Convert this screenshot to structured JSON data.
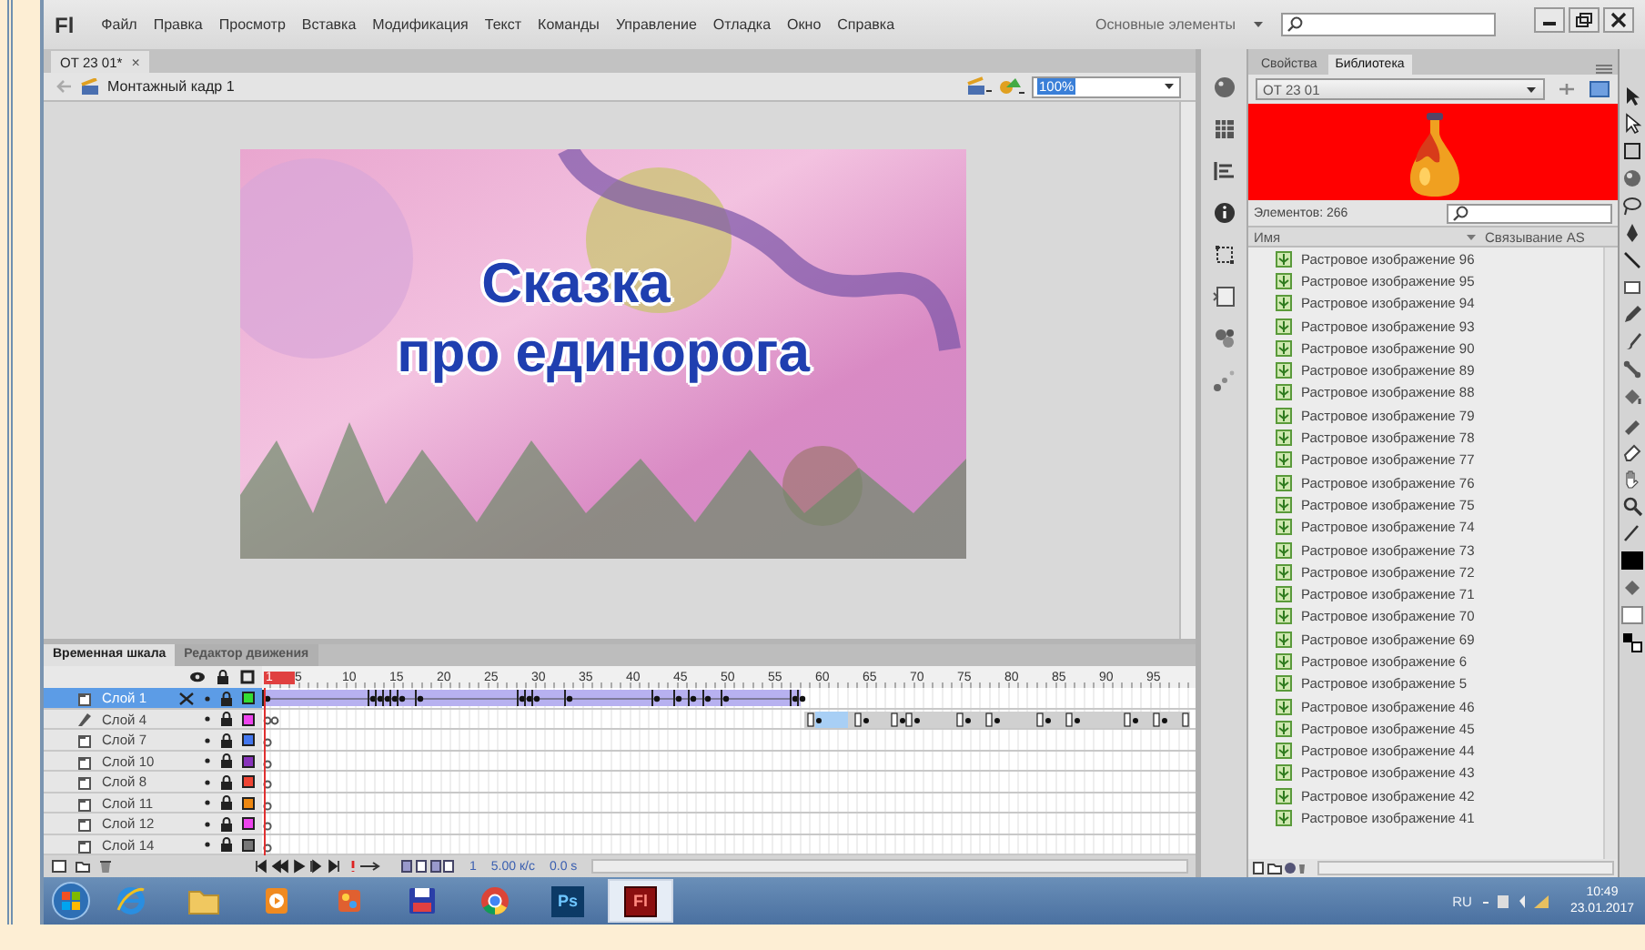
{
  "app": {
    "logo": "Fl",
    "menu": [
      "Файл",
      "Правка",
      "Просмотр",
      "Вставка",
      "Модификация",
      "Текст",
      "Команды",
      "Управление",
      "Отладка",
      "Окно",
      "Справка"
    ],
    "workspace": "Основные элементы"
  },
  "document_tab": {
    "title": "ОТ 23 01*",
    "close": "×"
  },
  "edit_bar": {
    "scene": "Монтажный кадр 1",
    "zoom": "100%"
  },
  "stage": {
    "lines": [
      "Сказка",
      "про единорога"
    ]
  },
  "timeline": {
    "tabs": [
      {
        "label": "Временная шкала",
        "selected": true
      },
      {
        "label": "Редактор движения",
        "selected": false
      }
    ],
    "frame_numbers": [
      "1",
      "5",
      "10",
      "15",
      "20",
      "25",
      "30",
      "35",
      "40",
      "45",
      "50",
      "55",
      "60",
      "65",
      "70",
      "75",
      "80",
      "85",
      "90",
      "95"
    ],
    "layers": [
      {
        "name": "Слой 1",
        "kind": "normal",
        "frames": {
          "kind": "tween"
        },
        "selected": true,
        "color": "#33dd33"
      },
      {
        "name": "Слой 4",
        "kind": "guide",
        "frames": {
          "kind": "keys"
        },
        "selected": false,
        "color": "#ee44ee"
      },
      {
        "name": "Слой 7",
        "kind": "normal",
        "frames": {
          "kind": "empty"
        },
        "selected": false,
        "color": "#4477ee"
      },
      {
        "name": "Слой 10",
        "kind": "normal",
        "frames": {
          "kind": "empty"
        },
        "selected": false,
        "color": "#8833bb"
      },
      {
        "name": "Слой 8",
        "kind": "normal",
        "frames": {
          "kind": "empty"
        },
        "selected": false,
        "color": "#ee4433"
      },
      {
        "name": "Слой 11",
        "kind": "normal",
        "frames": {
          "kind": "empty"
        },
        "selected": false,
        "color": "#ee8811"
      },
      {
        "name": "Слой 12",
        "kind": "normal",
        "frames": {
          "kind": "empty"
        },
        "selected": false,
        "color": "#ee44ee"
      },
      {
        "name": "Слой 14",
        "kind": "normal",
        "frames": {
          "kind": "empty"
        },
        "selected": false,
        "color": "#777777"
      }
    ],
    "current_frame": "1",
    "fps": "5.00 к/с",
    "time": "0.0 s"
  },
  "library": {
    "tabs": [
      {
        "label": "Свойства",
        "selected": false
      },
      {
        "label": "Библиотека",
        "selected": true
      }
    ],
    "document": "ОТ 23 01",
    "count": "Элементов: 266",
    "columns": [
      "Имя",
      "Связывание AS"
    ],
    "items": [
      "Растровое изображение 96",
      "Растровое изображение 95",
      "Растровое изображение 94",
      "Растровое изображение 93",
      "Растровое изображение 90",
      "Растровое изображение 89",
      "Растровое изображение 88",
      "Растровое изображение 79",
      "Растровое изображение 78",
      "Растровое изображение 77",
      "Растровое изображение 76",
      "Растровое изображение 75",
      "Растровое изображение 74",
      "Растровое изображение 73",
      "Растровое изображение 72",
      "Растровое изображение 71",
      "Растровое изображение 70",
      "Растровое изображение 69",
      "Растровое изображение 6",
      "Растровое изображение 5",
      "Растровое изображение 46",
      "Растровое изображение 45",
      "Растровое изображение 44",
      "Растровое изображение 43",
      "Растровое изображение 42",
      "Растровое изображение 41"
    ]
  },
  "taskbar": {
    "apps": [
      {
        "kind": "ie",
        "selected": false
      },
      {
        "kind": "folder",
        "selected": false
      },
      {
        "kind": "media",
        "selected": false
      },
      {
        "kind": "paint",
        "selected": false
      },
      {
        "kind": "floppy",
        "selected": false
      },
      {
        "kind": "chrome",
        "selected": false
      },
      {
        "kind": "ps",
        "label": "Ps",
        "selected": false
      },
      {
        "kind": "fl",
        "label": "Fl",
        "selected": true
      }
    ],
    "lang": "RU",
    "time": "10:49",
    "date": "23.01.2017"
  }
}
